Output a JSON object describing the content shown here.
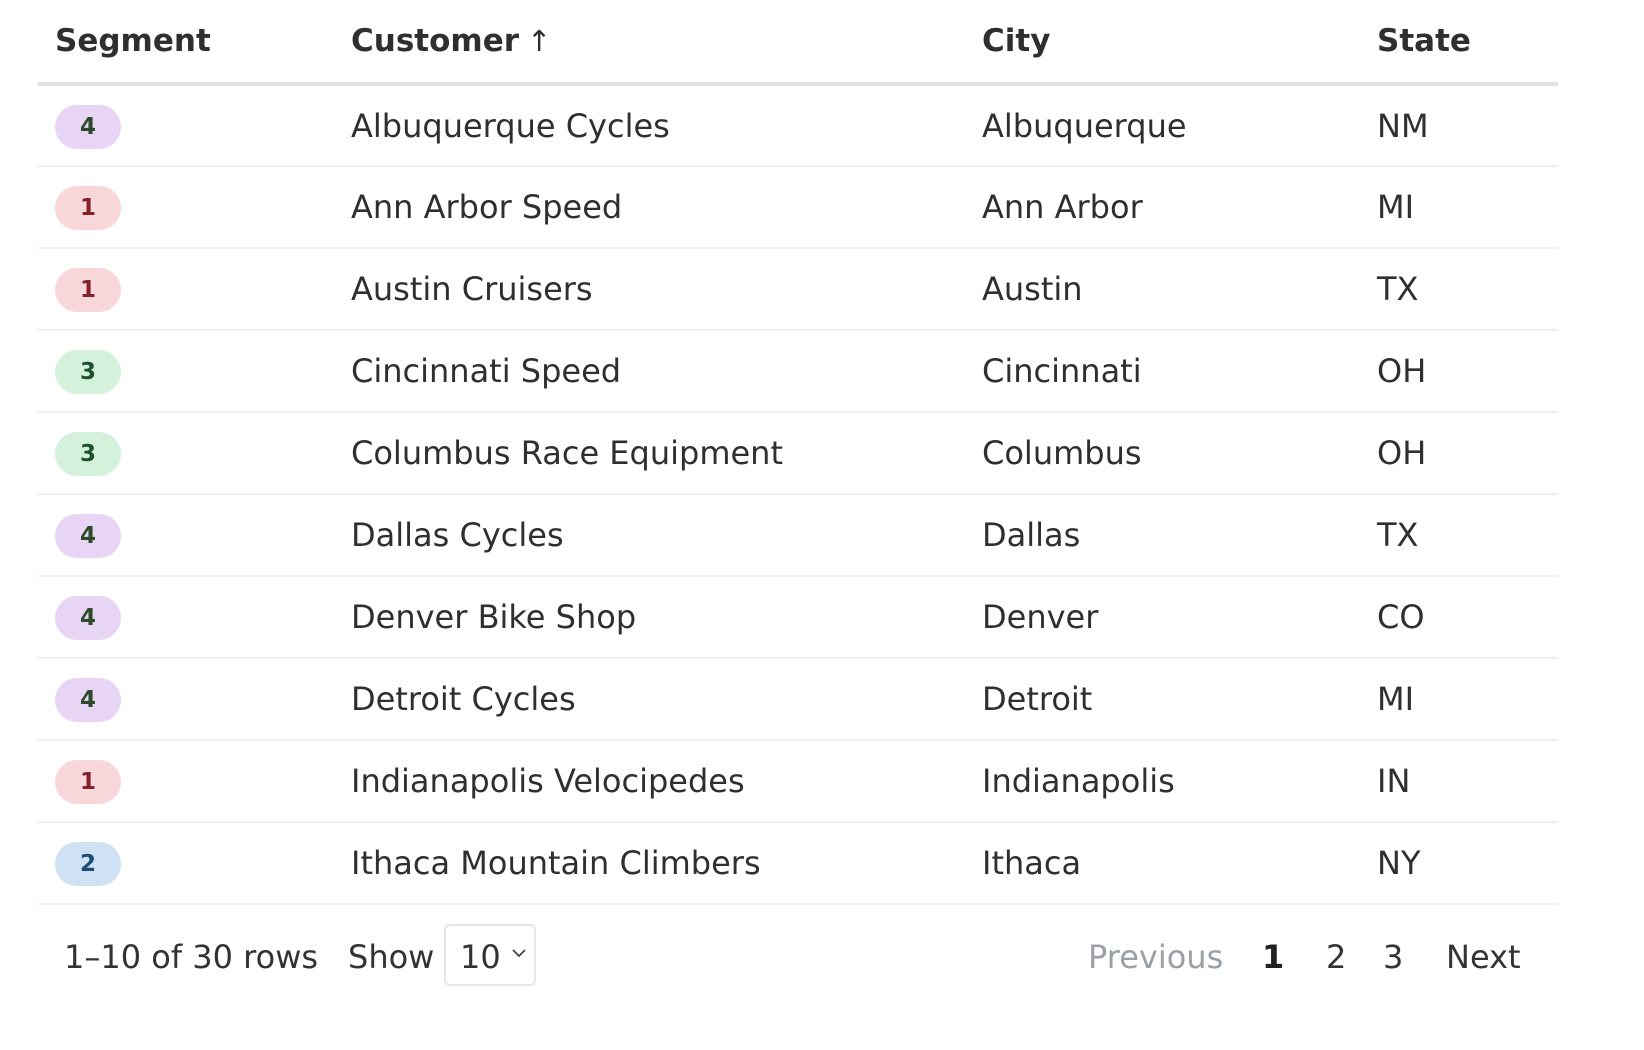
{
  "table": {
    "columns": [
      {
        "label": "Segment"
      },
      {
        "label": "Customer",
        "sort_icon": "↑"
      },
      {
        "label": "City"
      },
      {
        "label": "State"
      }
    ],
    "rows": [
      {
        "segment": "4",
        "customer": "Albuquerque Cycles",
        "city": "Albuquerque",
        "state": "NM"
      },
      {
        "segment": "1",
        "customer": "Ann Arbor Speed",
        "city": "Ann Arbor",
        "state": "MI"
      },
      {
        "segment": "1",
        "customer": "Austin Cruisers",
        "city": "Austin",
        "state": "TX"
      },
      {
        "segment": "3",
        "customer": "Cincinnati Speed",
        "city": "Cincinnati",
        "state": "OH"
      },
      {
        "segment": "3",
        "customer": "Columbus Race Equipment",
        "city": "Columbus",
        "state": "OH"
      },
      {
        "segment": "4",
        "customer": "Dallas Cycles",
        "city": "Dallas",
        "state": "TX"
      },
      {
        "segment": "4",
        "customer": "Denver Bike Shop",
        "city": "Denver",
        "state": "CO"
      },
      {
        "segment": "4",
        "customer": "Detroit Cycles",
        "city": "Detroit",
        "state": "MI"
      },
      {
        "segment": "1",
        "customer": "Indianapolis Velocipedes",
        "city": "Indianapolis",
        "state": "IN"
      },
      {
        "segment": "2",
        "customer": "Ithaca Mountain Climbers",
        "city": "Ithaca",
        "state": "NY"
      }
    ]
  },
  "segment_colors": {
    "1": {
      "bg": "#f8d7da",
      "fg": "#842029"
    },
    "2": {
      "bg": "#cfe2f3",
      "fg": "#1d4e7a"
    },
    "3": {
      "bg": "#d4f1dc",
      "fg": "#1f5130"
    },
    "4": {
      "bg": "#e8d5f5",
      "fg": "#2c4a2a"
    }
  },
  "footer": {
    "row_count": "1–10 of 30 rows",
    "show_label": "Show",
    "page_size": "10",
    "pagination": {
      "previous": "Previous",
      "pages": [
        "1",
        "2",
        "3"
      ],
      "next": "Next"
    }
  }
}
